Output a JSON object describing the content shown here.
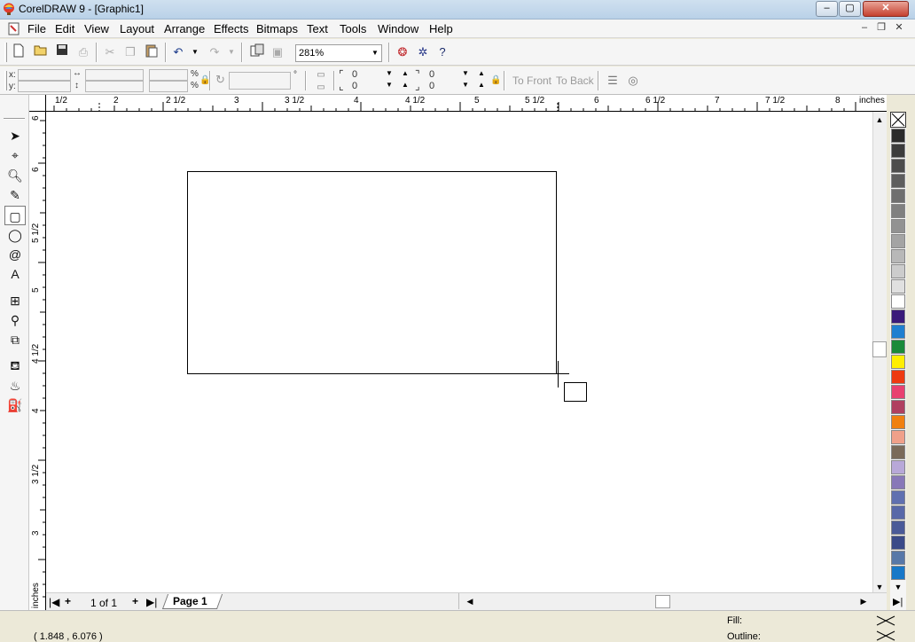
{
  "window": {
    "title": "CorelDRAW 9 - [Graphic1]",
    "minimize": "–",
    "maximize": "▢",
    "close": "✕",
    "doc_minimize": "–",
    "doc_restore": "❐",
    "doc_close": "✕"
  },
  "menu": [
    "File",
    "Edit",
    "View",
    "Layout",
    "Arrange",
    "Effects",
    "Bitmaps",
    "Text",
    "Tools",
    "Window",
    "Help"
  ],
  "standard_toolbar": {
    "zoom_value": "281%"
  },
  "property_bar": {
    "x_label": "x:",
    "y_label": "y:",
    "pct_symbol": "%",
    "corner_tl": "0",
    "corner_bl": "0",
    "corner_tr": "0",
    "corner_br": "0",
    "to_front": "To Front",
    "to_back": "To Back"
  },
  "ruler": {
    "unit": "inches",
    "h_labels": [
      "1/2",
      "2",
      "2 1/2",
      "3",
      "3 1/2",
      "4",
      "4 1/2",
      "5",
      "5 1/2",
      "6",
      "6 1/2",
      "7",
      "7 1/2",
      "8"
    ],
    "v_labels": [
      "6",
      "6",
      "5 1/2",
      "5",
      "4 1/2",
      "4",
      "3 1/2",
      "3"
    ],
    "v_unit": "inches"
  },
  "page_nav": {
    "first": "|◀",
    "add_before": "+",
    "page_count": "1 of 1",
    "add_after": "+",
    "last": "▶|",
    "page_tab": "Page 1"
  },
  "palette": {
    "colors": [
      "#2b2b2b",
      "#3c3c3c",
      "#4d4d4d",
      "#5e5e5e",
      "#6f6f6f",
      "#808080",
      "#929292",
      "#a4a4a4",
      "#b8b8b8",
      "#cccccc",
      "#e0e0e0",
      "#ffffff",
      "#3a1a7a",
      "#1f7fd0",
      "#1a8a3a",
      "#ffee00",
      "#ee3a10",
      "#e84070",
      "#b04060",
      "#f08010",
      "#f0a08a",
      "#7a6a5a",
      "#b8a8d8",
      "#8878b8",
      "#6070b0",
      "#5868a8",
      "#4a5a98",
      "#3a4a88",
      "#5878a8",
      "#1878c8"
    ]
  },
  "status": {
    "coords": "( 1.848 , 6.076 )",
    "fill_label": "Fill:",
    "outline_label": "Outline:"
  }
}
